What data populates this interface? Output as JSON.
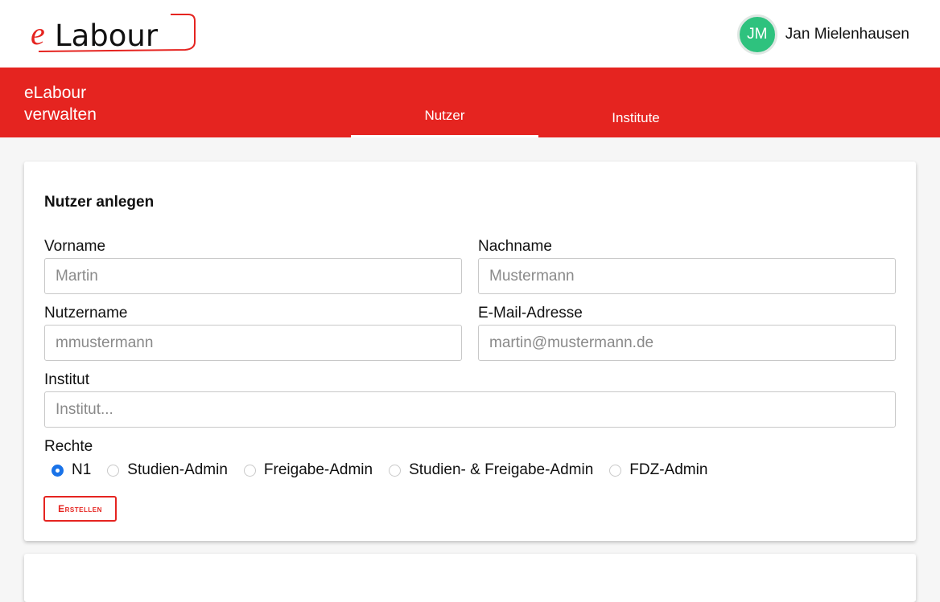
{
  "brand": {
    "logo_prefix": "e",
    "logo_rest": "Labour",
    "accent_color": "#e52420"
  },
  "user": {
    "initials": "JM",
    "name": "Jan Mielenhausen",
    "avatar_color": "#2ec27e"
  },
  "header": {
    "title_line1": "eLabour",
    "title_line2": "verwalten",
    "tabs": [
      {
        "label": "Nutzer",
        "active": true
      },
      {
        "label": "Institute",
        "active": false
      }
    ]
  },
  "form": {
    "title": "Nutzer anlegen",
    "fields": {
      "first_name": {
        "label": "Vorname",
        "placeholder": "Martin"
      },
      "last_name": {
        "label": "Nachname",
        "placeholder": "Mustermann"
      },
      "username": {
        "label": "Nutzername",
        "placeholder": "mmustermann"
      },
      "email": {
        "label": "E-Mail-Adresse",
        "placeholder": "martin@mustermann.de"
      },
      "institute": {
        "label": "Institut",
        "placeholder": "Institut..."
      }
    },
    "rights": {
      "label": "Rechte",
      "options": [
        {
          "label": "N1",
          "checked": true
        },
        {
          "label": "Studien-Admin",
          "checked": false
        },
        {
          "label": "Freigabe-Admin",
          "checked": false
        },
        {
          "label": "Studien- & Freigabe-Admin",
          "checked": false
        },
        {
          "label": "FDZ-Admin",
          "checked": false
        }
      ]
    },
    "submit_label": "Erstellen"
  }
}
